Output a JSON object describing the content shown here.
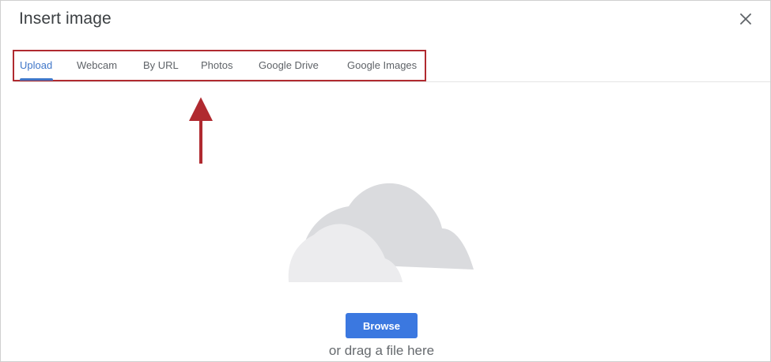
{
  "dialog": {
    "title": "Insert image",
    "close_icon": "close-icon"
  },
  "tabs": [
    {
      "label": "Upload",
      "active": true
    },
    {
      "label": "Webcam",
      "active": false
    },
    {
      "label": "By URL",
      "active": false
    },
    {
      "label": "Photos",
      "active": false
    },
    {
      "label": "Google Drive",
      "active": false
    },
    {
      "label": "Google Images",
      "active": false
    }
  ],
  "upload": {
    "illustration_icon": "cloud-icon",
    "browse_label": "Browse",
    "drag_text": "or drag a file here"
  },
  "annotation": {
    "arrow_icon": "arrow-up-icon",
    "highlight_color": "#b02a30"
  },
  "colors": {
    "accent": "#3f76c8",
    "button": "#3b78e0"
  }
}
